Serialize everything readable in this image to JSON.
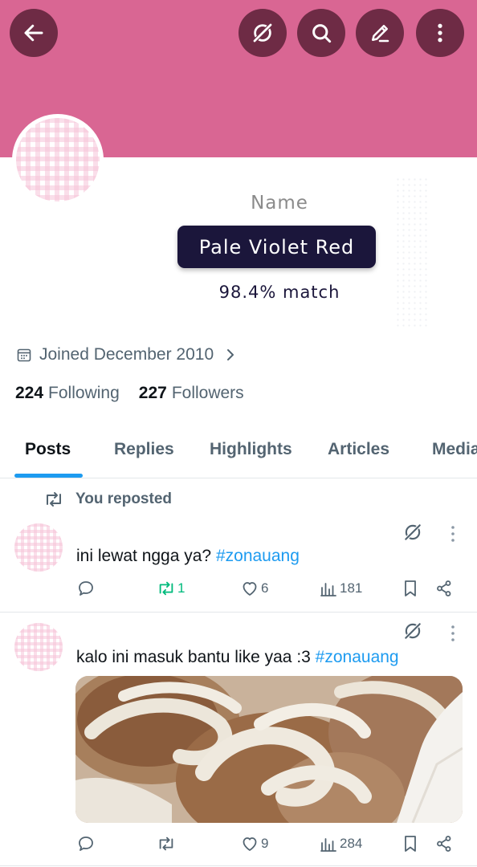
{
  "header": {
    "back_icon": "arrow-left-icon",
    "grok_icon": "grok-icon",
    "search_icon": "search-icon",
    "edit_icon": "edit-icon",
    "more_icon": "more-vertical-icon",
    "banner_color": "#d96693"
  },
  "name_card": {
    "label": "Name",
    "color_name": "Pale Violet Red",
    "match": "98.4% match"
  },
  "profile": {
    "joined": "Joined December 2010",
    "following_count": "224",
    "following_label": "Following",
    "followers_count": "227",
    "followers_label": "Followers"
  },
  "tabs": [
    "Posts",
    "Replies",
    "Highlights",
    "Articles",
    "Media"
  ],
  "repost_note": "You reposted",
  "posts": [
    {
      "text": "ini lewat ngga ya?",
      "hashtag": "#zonauang",
      "retweets": "1",
      "likes": "6",
      "views": "181"
    },
    {
      "text": "kalo ini masuk bantu like yaa :3",
      "hashtag": "#zonauang",
      "retweets": "",
      "likes": "9",
      "views": "284"
    }
  ],
  "colors": {
    "accent": "#1d9bf0",
    "retweet_active": "#00ba7c",
    "banner": "#d96693",
    "button_bg": "#6e2b45",
    "pill_bg": "#1b163b"
  }
}
